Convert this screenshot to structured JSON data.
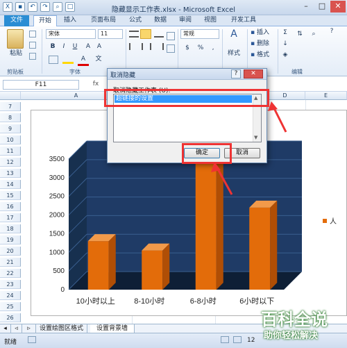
{
  "window": {
    "title": "隐藏显示工作表.xlsx - Microsoft Excel"
  },
  "tabs": [
    "文件",
    "开始",
    "插入",
    "页面布局",
    "公式",
    "数据",
    "审阅",
    "视图",
    "开发工具"
  ],
  "ribbon": {
    "paste": "粘贴",
    "font_name": "宋体",
    "font_size": "11",
    "number_format": "常规",
    "insert": "插入",
    "delete": "删除",
    "format": "格式",
    "styles": "样式",
    "groups": {
      "clipboard": "剪贴板",
      "font": "字体",
      "editing": "编辑"
    }
  },
  "namebox": "F11",
  "columns": [
    "A",
    "B",
    "C",
    "D",
    "E"
  ],
  "rows": [
    "7",
    "8",
    "9",
    "10",
    "11",
    "12",
    "13",
    "14",
    "15",
    "16",
    "17",
    "18",
    "19",
    "20",
    "21",
    "22",
    "23",
    "24",
    "25",
    "26"
  ],
  "dialog": {
    "title": "取消隐藏",
    "label": "取消隐藏工作表 (U):",
    "list_item": "超链接的设置",
    "ok": "确定",
    "cancel": "取消"
  },
  "chart_data": {
    "type": "bar",
    "categories": [
      "10小时以上",
      "8-10小时",
      "6-8小时",
      "6小时以下"
    ],
    "series": [
      {
        "name": "人",
        "values": [
          1300,
          1050,
          3500,
          2200
        ]
      }
    ],
    "ylim": [
      0,
      3500
    ],
    "yticks": [
      "0",
      "500",
      "1000",
      "1500",
      "2000",
      "2500",
      "3000",
      "3500"
    ],
    "bar_color": "#e36c0a",
    "background": "#1f3b66"
  },
  "sheets": [
    "设置绘图区格式",
    "设置背景墙"
  ],
  "status": {
    "ready": "就绪",
    "zoom": "12"
  },
  "watermark": {
    "line1": "百科全说",
    "line2": "助你轻松解决"
  }
}
